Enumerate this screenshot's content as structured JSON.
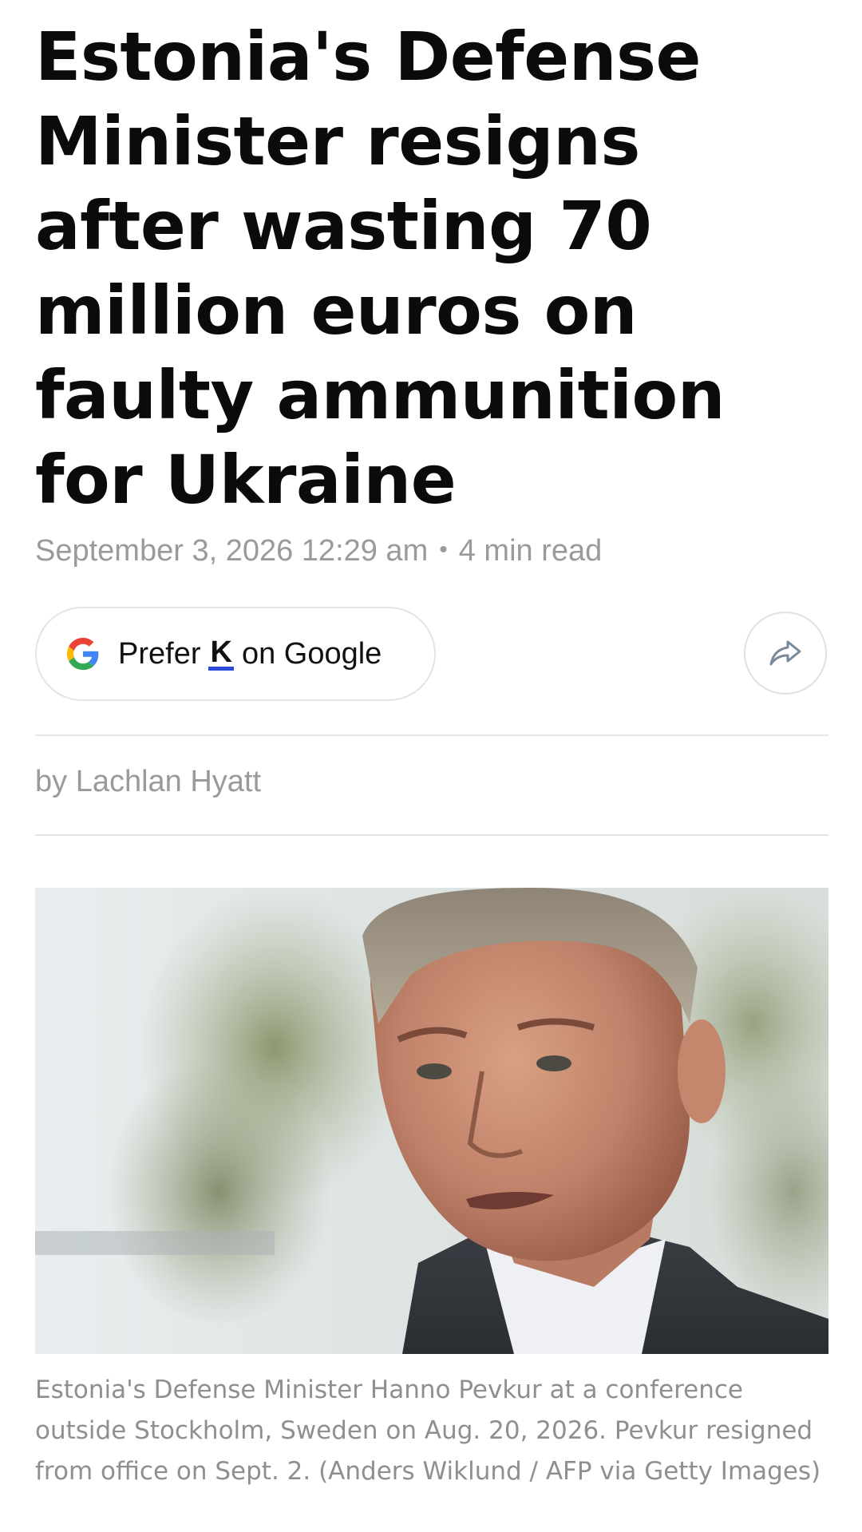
{
  "article": {
    "headline": "Estonia's Defense Minister resigns after wasting 70 million euros on faulty ammunition for Ukraine",
    "date": "September 3, 2026 12:29 am",
    "separator": "•",
    "read_time": "4 min read",
    "byline": "by Lachlan Hyatt",
    "caption": "Estonia's Defense Minister Hanno Pevkur at a conference outside Stockholm, Sweden on Aug. 20, 2026. Pevkur resigned from office on Sept. 2. (Anders Wiklund / AFP via Getty Images)"
  },
  "prefer_button": {
    "prefix": "Prefer",
    "logo_letter": "K",
    "suffix": "on Google",
    "icon": "google-g-icon"
  },
  "share_button": {
    "icon": "share-arrow-icon"
  },
  "colors": {
    "headline": "#0b0b0b",
    "meta_text": "#9a9a9a",
    "caption_text": "#8f8f8f",
    "divider": "#e6e6e6",
    "k_underline": "#2b4bd8"
  }
}
